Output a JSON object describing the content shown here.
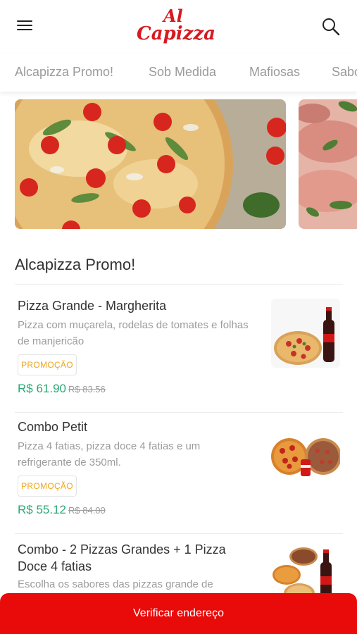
{
  "header": {
    "logo_line1": "Al",
    "logo_line2": "Capizza",
    "menu_icon": "hamburger-menu-icon",
    "search_icon": "search-icon"
  },
  "categories": [
    "Alcapizza Promo!",
    "Sob Medida",
    "Mafiosas",
    "Sabo"
  ],
  "section": {
    "title": "Alcapizza Promo!"
  },
  "products": [
    {
      "name": "Pizza Grande - Margherita",
      "description": "Pizza com muçarela, rodelas de tomates e folhas de manjericão",
      "badge": "PROMOÇÃO",
      "price": "R$ 61.90",
      "old_price": "R$ 83.56"
    },
    {
      "name": "Combo Petit",
      "description": "Pizza 4 fatias, pizza doce 4 fatias e um refrigerante de 350ml.",
      "badge": "PROMOÇÃO",
      "price": "R$ 55.12",
      "old_price": "R$ 84.00"
    },
    {
      "name": "Combo - 2 Pizzas Grandes + 1 Pizza Doce 4 fatias",
      "description": "Escolha os sabores das pizzas grande de"
    }
  ],
  "cta": {
    "label": "Verificar endereço"
  },
  "colors": {
    "brand_red": "#e90a0a",
    "price_green": "#2aa873",
    "promo_orange": "#f0a61c"
  }
}
